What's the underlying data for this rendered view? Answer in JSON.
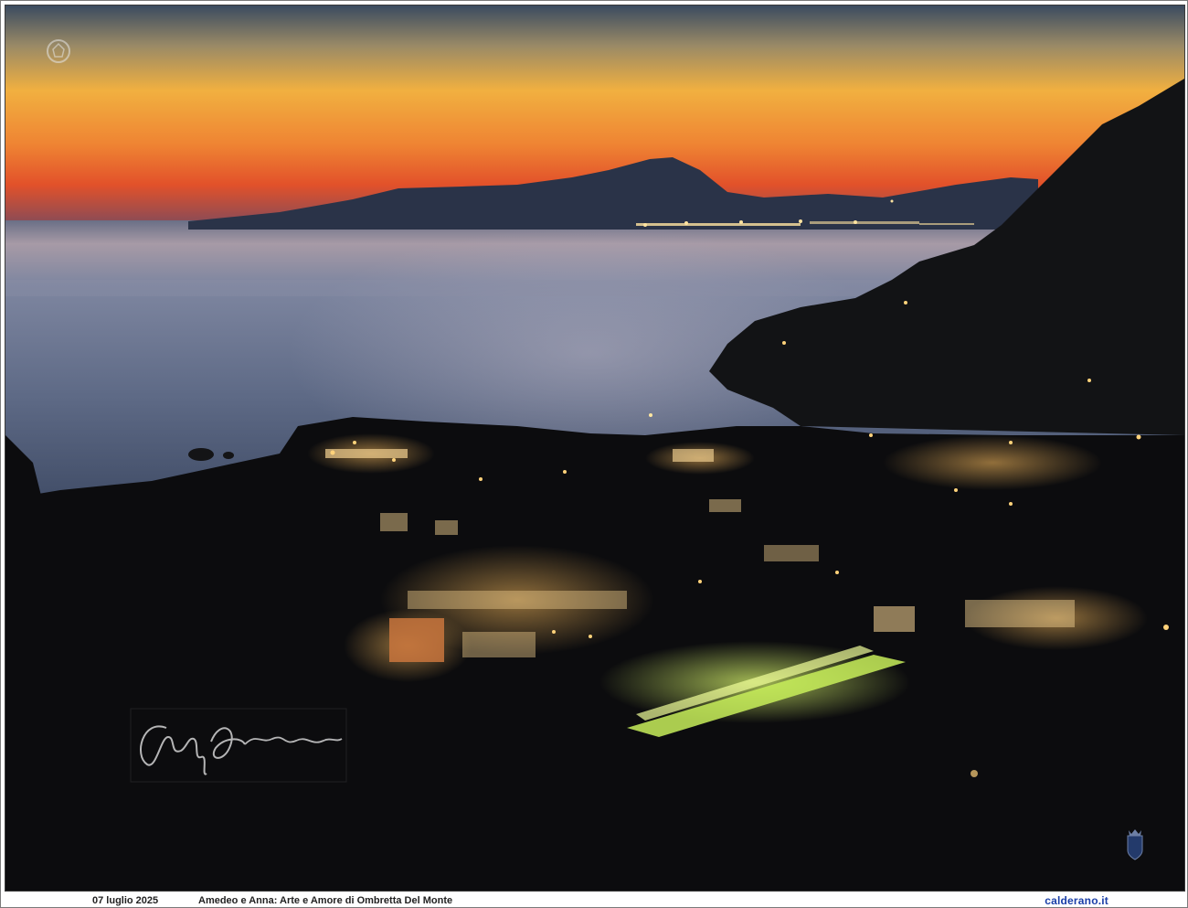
{
  "caption": {
    "date": "07 luglio  2025",
    "title": "Amedeo e Anna: Arte e Amore di Ombretta Del Monte",
    "site": "calderano.it"
  },
  "photo": {
    "subject": "coastal-bay-at-dusk",
    "colors": {
      "sky_top": "#3f4e63",
      "sky_mid": "#f0a83c",
      "sky_horizon": "#ec5a2a",
      "sea": "#5c6a86",
      "land": "#0d0d0f",
      "lights": "#ffd27a",
      "station_lights": "#d8ff6a"
    }
  }
}
